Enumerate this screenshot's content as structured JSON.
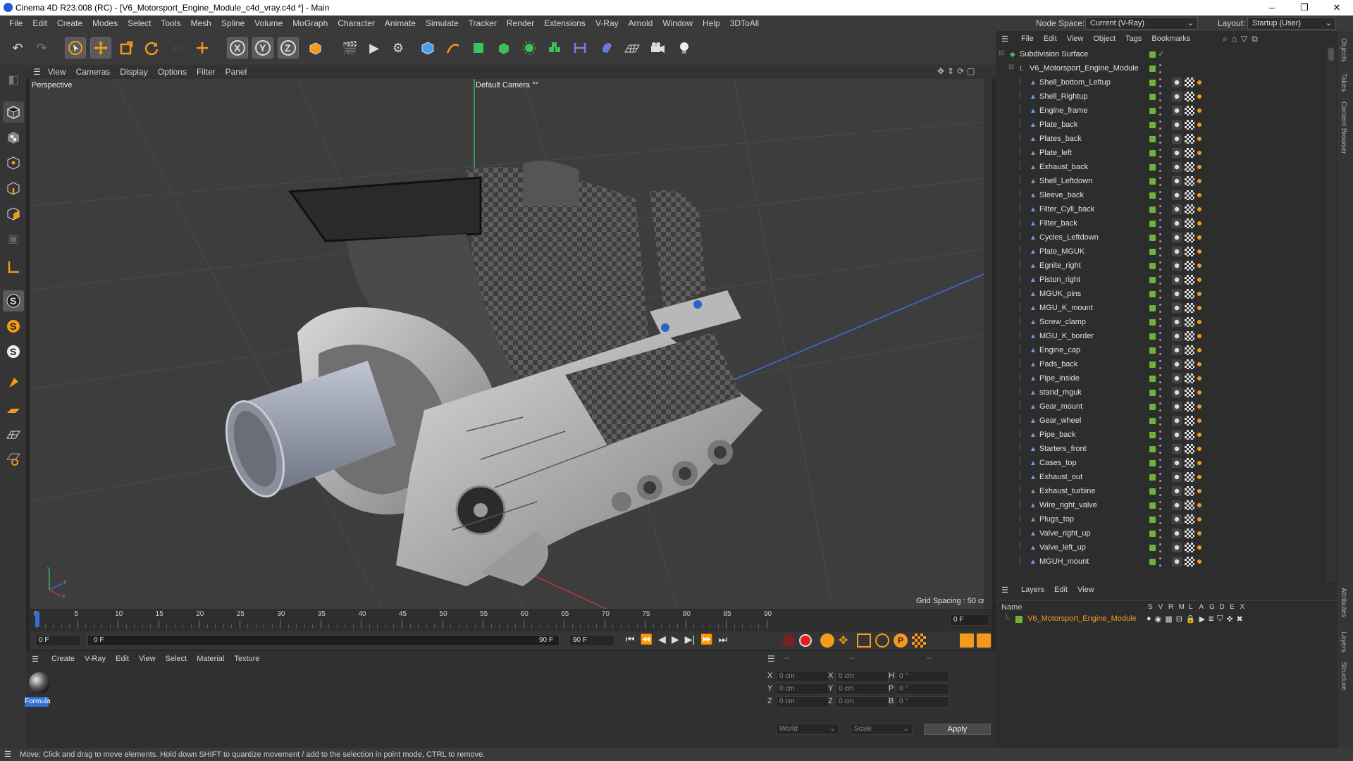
{
  "window": {
    "title": "Cinema 4D R23.008 (RC) - [V6_Motorsport_Engine_Module_c4d_vray.c4d *] - Main",
    "controls": [
      "–",
      "❐",
      "✕"
    ]
  },
  "menu": [
    "File",
    "Edit",
    "Create",
    "Modes",
    "Select",
    "Tools",
    "Mesh",
    "Spline",
    "Volume",
    "MoGraph",
    "Character",
    "Animate",
    "Simulate",
    "Tracker",
    "Render",
    "Extensions",
    "V-Ray",
    "Arnold",
    "Window",
    "Help",
    "3DToAll"
  ],
  "node_space": {
    "label": "Node Space:",
    "value": "Current (V-Ray)"
  },
  "layout": {
    "label": "Layout:",
    "value": "Startup (User)"
  },
  "viewport": {
    "menu": [
      "View",
      "Cameras",
      "Display",
      "Options",
      "Filter",
      "Panel"
    ],
    "name": "Perspective",
    "camera": "Default Camera",
    "grid_spacing": "Grid Spacing : 50 cm",
    "axes": {
      "y": "y",
      "z": "z",
      "x": "x"
    }
  },
  "timeline": {
    "ticks": [
      "0",
      "5",
      "10",
      "15",
      "20",
      "25",
      "30",
      "35",
      "40",
      "45",
      "50",
      "55",
      "60",
      "65",
      "70",
      "75",
      "80",
      "85",
      "90"
    ],
    "current": "0 F"
  },
  "playbar": {
    "start": "0 F",
    "range_start": "0 F",
    "range_end": "90 F",
    "end": "90 F"
  },
  "material_manager": {
    "menu": [
      "Create",
      "V-Ray",
      "Edit",
      "View",
      "Select",
      "Material",
      "Texture"
    ],
    "material": "Formula"
  },
  "coordinates": {
    "headers": [
      "--",
      "--",
      "--"
    ],
    "rows": [
      {
        "a": "X",
        "av": "0 cm",
        "b": "X",
        "bv": "0 cm",
        "c": "H",
        "cv": "0 °"
      },
      {
        "a": "Y",
        "av": "0 cm",
        "b": "Y",
        "bv": "0 cm",
        "c": "P",
        "cv": "0 °"
      },
      {
        "a": "Z",
        "av": "0 cm",
        "b": "Z",
        "bv": "0 cm",
        "c": "B",
        "cv": "0 °"
      }
    ],
    "space": "World",
    "mode": "Scale",
    "apply": "Apply"
  },
  "object_manager": {
    "menu": [
      "File",
      "Edit",
      "View",
      "Object",
      "Tags",
      "Bookmarks"
    ],
    "root": "Subdivision Surface",
    "group": "V6_Motorsport_Engine_Module",
    "objects": [
      "Shell_bottom_Leftup",
      "Shell_Rightup",
      "Engine_frame",
      "Plate_back",
      "Plates_back",
      "Plate_left",
      "Exhaust_back",
      "Shell_Leftdown",
      "Sleeve_back",
      "Filter_Cyll_back",
      "Filter_back",
      "Cycles_Leftdown",
      "Plate_MGUK",
      "Egnite_right",
      "Piston_right",
      "MGUK_pins",
      "MGU_K_mount",
      "Screw_clamp",
      "MGU_K_border",
      "Engine_cap",
      "Pads_back",
      "Pipe_inside",
      "stand_mguk",
      "Gear_mount",
      "Gear_wheel",
      "Pipe_back",
      "Starters_front",
      "Cases_top",
      "Exhaust_out",
      "Exhaust_turbine",
      "Wire_right_valve",
      "Plugs_top",
      "Valve_right_up",
      "Valve_left_up",
      "MGUH_mount"
    ]
  },
  "layer_manager": {
    "menu": [
      "Layers",
      "Edit",
      "View"
    ],
    "name_header": "Name",
    "flags": [
      "S",
      "V",
      "R",
      "M",
      "L",
      "A",
      "G",
      "D",
      "E",
      "X"
    ],
    "layer": "V6_Motorsport_Engine_Module"
  },
  "side_tabs": [
    "Objects",
    "Takes",
    "Content Browser",
    "Attributes",
    "Layers",
    "Structure"
  ],
  "status": "Move: Click and drag to move elements. Hold down SHIFT to quantize movement / add to the selection in point mode, CTRL to remove.",
  "colors": {
    "accent_orange": "#f39a1d",
    "layer_green": "#6eb23a",
    "selection_blue": "#2f6fd6"
  }
}
